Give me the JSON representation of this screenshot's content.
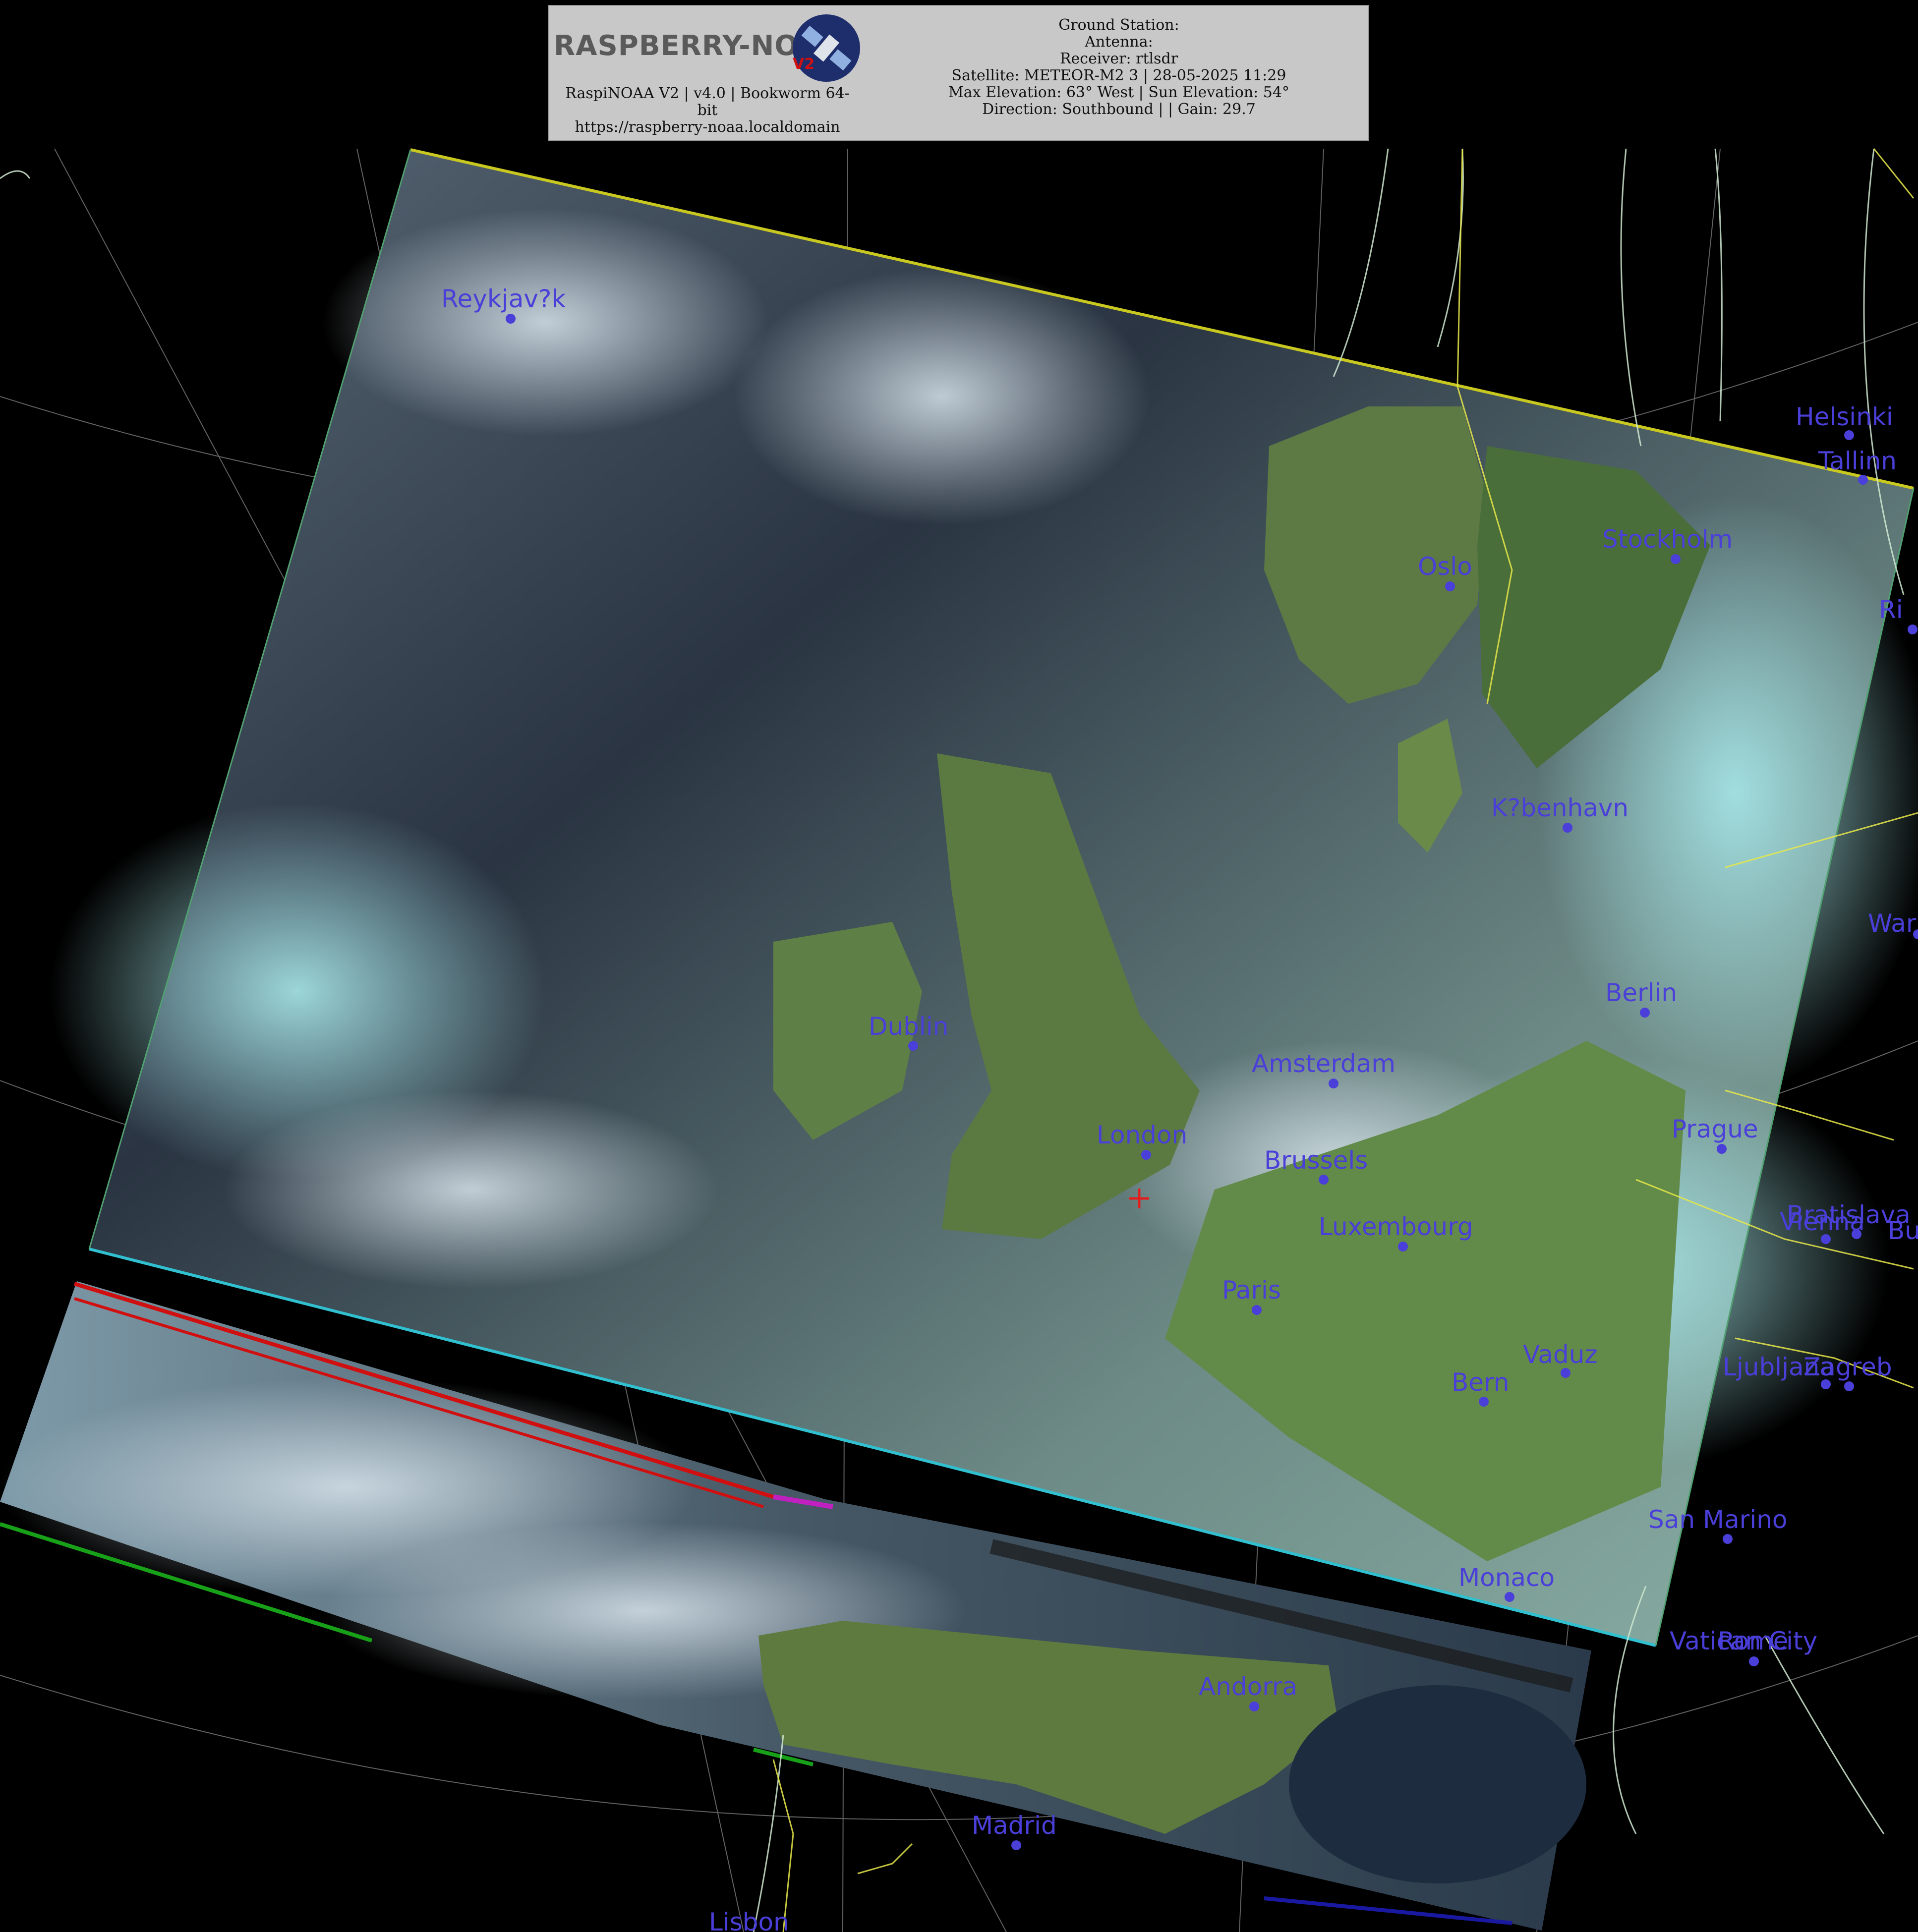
{
  "header": {
    "logo": "RASPBERRY-NOAA",
    "logo_version": "V2",
    "station_lines": [
      "RaspiNOAA V2 | v4.0 | Bookworm 64-",
      "bit",
      "https://raspberry-noaa.localdomain"
    ],
    "pass_lines": [
      "Ground Station:",
      "Antenna:",
      "Receiver: rtlsdr",
      "Satellite: METEOR-M2 3 | 28-05-2025 11:29",
      "Max Elevation: 63° West | Sun Elevation: 54°",
      "Direction: Southbound | | Gain: 29.7"
    ]
  },
  "cities": [
    "Reykjav?k",
    "Helsinki",
    "Tallinn",
    "Stockholm",
    "Oslo",
    "Ri",
    "K?benhavn",
    "War",
    "Berlin",
    "Dublin",
    "Amsterdam",
    "London",
    "Brussels",
    "Prague",
    "Luxembourg",
    "Bratislava",
    "Vienna",
    "Bu",
    "Paris",
    "Vaduz",
    "Bern",
    "Ljubljana",
    "Zagreb",
    "San Marino",
    "Monaco",
    "Vatican City",
    "Rome",
    "Andorra",
    "Madrid",
    "Lisbon"
  ],
  "colors": {
    "city_marker": "#4a3fd8",
    "country_border": "#e8e84a",
    "coastline": "#cfe8d0",
    "graticule": "#9a9a9a",
    "station_marker": "#e02020",
    "swath_edge_top": "#c8c820",
    "swath_edge_bottom": "#30c0d0"
  }
}
